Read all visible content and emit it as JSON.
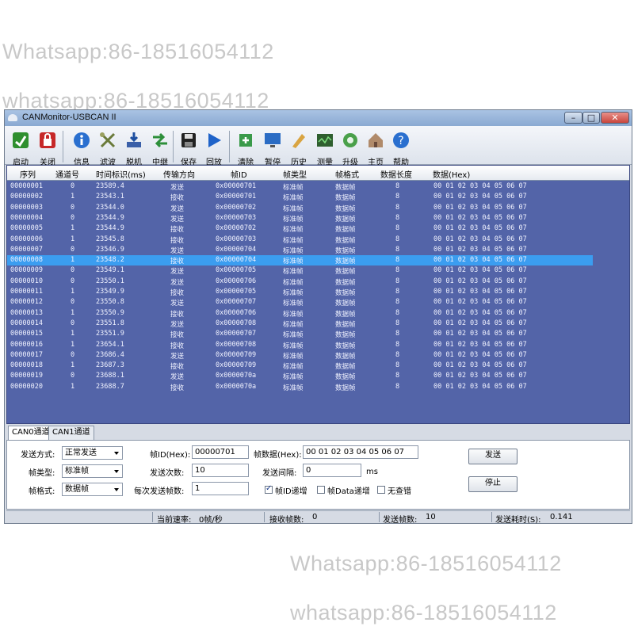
{
  "watermarks": [
    "Whatsapp:86-18516054112",
    "whatsapp:86-18516054112",
    "Whatsapp:86-18516054112",
    "whatsapp:86-18516054112"
  ],
  "window": {
    "title": "CANMonitor-USBCAN II"
  },
  "toolbar": [
    {
      "label": "启动",
      "icon": "start-icon"
    },
    {
      "label": "关闭",
      "icon": "close-device-icon"
    },
    {
      "label": "信息",
      "icon": "info-icon"
    },
    {
      "label": "滤波",
      "icon": "filter-icon"
    },
    {
      "label": "脱机",
      "icon": "offline-icon"
    },
    {
      "label": "中继",
      "icon": "relay-icon"
    },
    {
      "label": "保存",
      "icon": "save-icon"
    },
    {
      "label": "回放",
      "icon": "playback-icon"
    },
    {
      "label": "清除",
      "icon": "clear-icon"
    },
    {
      "label": "暂停",
      "icon": "pause-icon"
    },
    {
      "label": "历史",
      "icon": "history-icon"
    },
    {
      "label": "测量",
      "icon": "measure-icon"
    },
    {
      "label": "升级",
      "icon": "upgrade-icon"
    },
    {
      "label": "主页",
      "icon": "home-icon"
    },
    {
      "label": "帮助",
      "icon": "help-icon"
    }
  ],
  "grid": {
    "columns": [
      "序列",
      "通道号",
      "时间标识(ms)",
      "传输方向",
      "帧ID",
      "帧类型",
      "帧格式",
      "数据长度",
      "数据(Hex)"
    ],
    "selected_index": 7,
    "rows": [
      [
        "00000001",
        "0",
        "23589.4",
        "发送",
        "0x00000701",
        "标准帧",
        "数据帧",
        "8",
        "00 01 02 03 04 05 06 07"
      ],
      [
        "00000002",
        "1",
        "23543.1",
        "接收",
        "0x00000701",
        "标准帧",
        "数据帧",
        "8",
        "00 01 02 03 04 05 06 07"
      ],
      [
        "00000003",
        "0",
        "23544.0",
        "发送",
        "0x00000702",
        "标准帧",
        "数据帧",
        "8",
        "00 01 02 03 04 05 06 07"
      ],
      [
        "00000004",
        "0",
        "23544.9",
        "发送",
        "0x00000703",
        "标准帧",
        "数据帧",
        "8",
        "00 01 02 03 04 05 06 07"
      ],
      [
        "00000005",
        "1",
        "23544.9",
        "接收",
        "0x00000702",
        "标准帧",
        "数据帧",
        "8",
        "00 01 02 03 04 05 06 07"
      ],
      [
        "00000006",
        "1",
        "23545.8",
        "接收",
        "0x00000703",
        "标准帧",
        "数据帧",
        "8",
        "00 01 02 03 04 05 06 07"
      ],
      [
        "00000007",
        "0",
        "23546.9",
        "发送",
        "0x00000704",
        "标准帧",
        "数据帧",
        "8",
        "00 01 02 03 04 05 06 07"
      ],
      [
        "00000008",
        "1",
        "23548.2",
        "接收",
        "0x00000704",
        "标准帧",
        "数据帧",
        "8",
        "00 01 02 03 04 05 06 07"
      ],
      [
        "00000009",
        "0",
        "23549.1",
        "发送",
        "0x00000705",
        "标准帧",
        "数据帧",
        "8",
        "00 01 02 03 04 05 06 07"
      ],
      [
        "00000010",
        "0",
        "23550.1",
        "发送",
        "0x00000706",
        "标准帧",
        "数据帧",
        "8",
        "00 01 02 03 04 05 06 07"
      ],
      [
        "00000011",
        "1",
        "23549.9",
        "接收",
        "0x00000705",
        "标准帧",
        "数据帧",
        "8",
        "00 01 02 03 04 05 06 07"
      ],
      [
        "00000012",
        "0",
        "23550.8",
        "发送",
        "0x00000707",
        "标准帧",
        "数据帧",
        "8",
        "00 01 02 03 04 05 06 07"
      ],
      [
        "00000013",
        "1",
        "23550.9",
        "接收",
        "0x00000706",
        "标准帧",
        "数据帧",
        "8",
        "00 01 02 03 04 05 06 07"
      ],
      [
        "00000014",
        "0",
        "23551.8",
        "发送",
        "0x00000708",
        "标准帧",
        "数据帧",
        "8",
        "00 01 02 03 04 05 06 07"
      ],
      [
        "00000015",
        "1",
        "23551.9",
        "接收",
        "0x00000707",
        "标准帧",
        "数据帧",
        "8",
        "00 01 02 03 04 05 06 07"
      ],
      [
        "00000016",
        "1",
        "23654.1",
        "接收",
        "0x00000708",
        "标准帧",
        "数据帧",
        "8",
        "00 01 02 03 04 05 06 07"
      ],
      [
        "00000017",
        "0",
        "23686.4",
        "发送",
        "0x00000709",
        "标准帧",
        "数据帧",
        "8",
        "00 01 02 03 04 05 06 07"
      ],
      [
        "00000018",
        "1",
        "23687.3",
        "接收",
        "0x00000709",
        "标准帧",
        "数据帧",
        "8",
        "00 01 02 03 04 05 06 07"
      ],
      [
        "00000019",
        "0",
        "23688.1",
        "发送",
        "0x0000070a",
        "标准帧",
        "数据帧",
        "8",
        "00 01 02 03 04 05 06 07"
      ],
      [
        "00000020",
        "1",
        "23688.7",
        "接收",
        "0x0000070a",
        "标准帧",
        "数据帧",
        "8",
        "00 01 02 03 04 05 06 07"
      ]
    ]
  },
  "tabs": [
    "CAN0通道",
    "CAN1通道"
  ],
  "form": {
    "send_mode_label": "发送方式:",
    "send_mode_value": "正常发送",
    "frame_type_label": "帧类型:",
    "frame_type_value": "标准帧",
    "frame_format_label": "帧格式:",
    "frame_format_value": "数据帧",
    "frame_id_label": "帧ID(Hex):",
    "frame_id_value": "00000701",
    "send_count_label": "发送次数:",
    "send_count_value": "10",
    "per_send_label": "每次发送帧数:",
    "per_send_value": "1",
    "frame_data_label": "帧数据(Hex):",
    "frame_data_value": "00 01 02 03 04 05 06 07",
    "interval_label": "发送间隔:",
    "interval_value": "0",
    "interval_unit": "ms",
    "chk_id_inc": "帧ID递增",
    "chk_data_inc": "帧Data递增",
    "chk_no_err": "无查错",
    "send_button": "发送",
    "stop_button": "停止"
  },
  "status": {
    "rate_label": "当前速率:",
    "rate_value": "0帧/秒",
    "recv_label": "接收帧数:",
    "recv_value": "0",
    "sent_label": "发送帧数:",
    "sent_value": "10",
    "time_label": "发送耗时(S):",
    "time_value": "0.141"
  },
  "colors": {
    "grid_bg": "#5364a8",
    "selected_row": "#3b9df0",
    "titlebar": "#9bb6db",
    "close_button": "#c9463d"
  }
}
